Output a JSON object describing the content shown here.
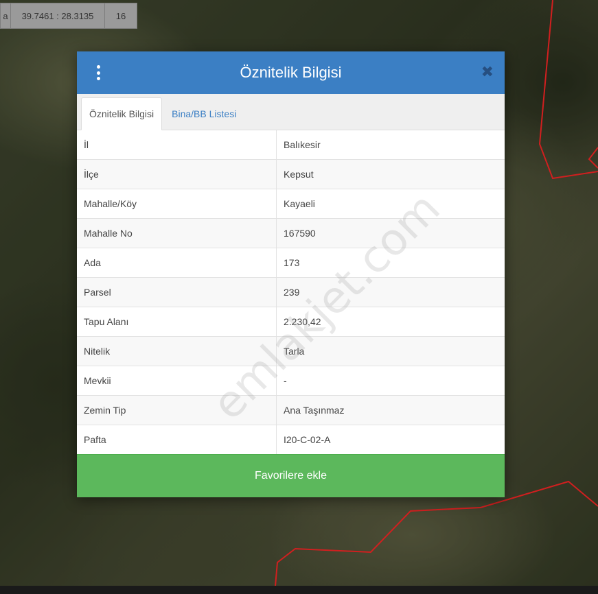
{
  "toolbar": {
    "lead": "a",
    "coordinates": "39.7461 : 28.3135",
    "zoom": "16"
  },
  "modal": {
    "title": "Öznitelik Bilgisi",
    "menu_icon": "vertical-ellipsis-icon",
    "close_icon": "close-icon",
    "close_symbol": "✖",
    "tabs": [
      {
        "label": "Öznitelik Bilgisi",
        "active": true
      },
      {
        "label": "Bina/BB Listesi",
        "active": false
      }
    ],
    "rows": [
      {
        "key": "İl",
        "value": "Balıkesir"
      },
      {
        "key": "İlçe",
        "value": "Kepsut"
      },
      {
        "key": "Mahalle/Köy",
        "value": "Kayaeli"
      },
      {
        "key": "Mahalle No",
        "value": "167590"
      },
      {
        "key": "Ada",
        "value": "173"
      },
      {
        "key": "Parsel",
        "value": "239"
      },
      {
        "key": "Tapu Alanı",
        "value": "2.230,42"
      },
      {
        "key": "Nitelik",
        "value": "Tarla"
      },
      {
        "key": "Mevkii",
        "value": "-"
      },
      {
        "key": "Zemin Tip",
        "value": "Ana Taşınmaz"
      },
      {
        "key": "Pafta",
        "value": "I20-C-02-A"
      }
    ],
    "favorite_button": "Favorilere ekle"
  },
  "watermark": "emlakjet.com",
  "colors": {
    "header_blue": "#3b7fc4",
    "button_green": "#5cb85c",
    "parcel_red": "#d11f1f"
  }
}
